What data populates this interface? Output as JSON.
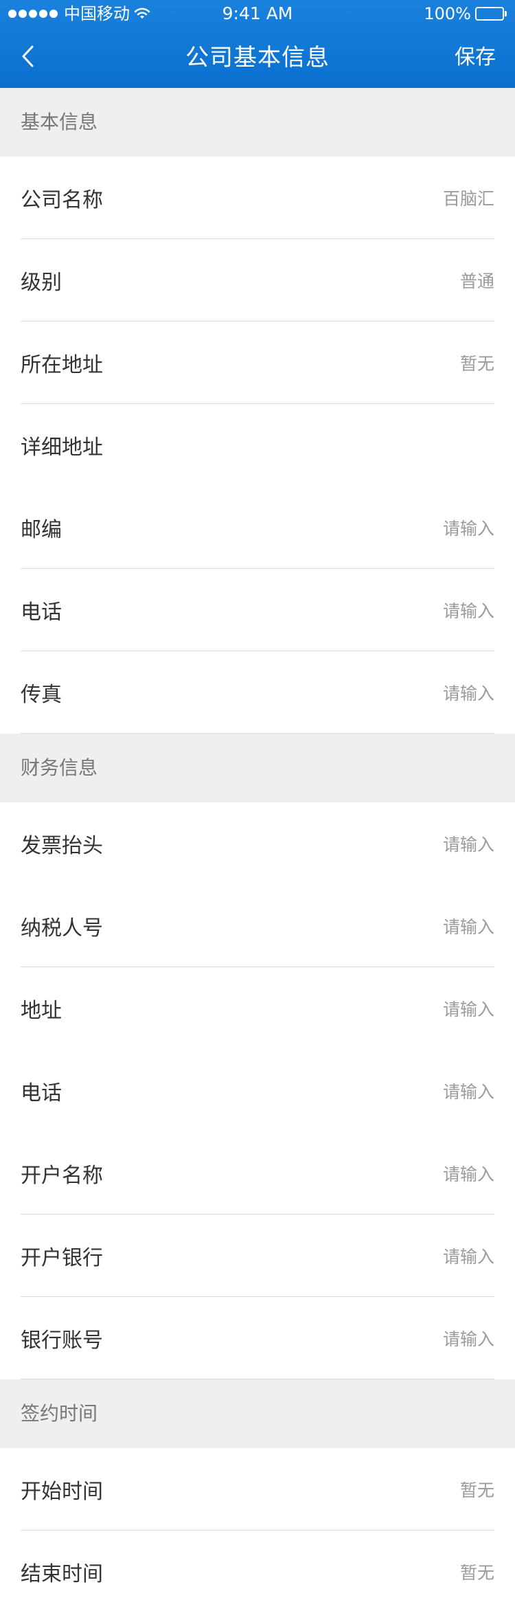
{
  "status_bar": {
    "carrier": "中国移动",
    "time": "9:41 AM",
    "battery": "100%"
  },
  "nav": {
    "title": "公司基本信息",
    "save_label": "保存"
  },
  "sections": [
    {
      "title": "基本信息",
      "rows": [
        {
          "label": "公司名称",
          "value": "百脑汇"
        },
        {
          "label": "级别",
          "value": "普通"
        },
        {
          "label": "所在地址",
          "value": "暂无"
        },
        {
          "label": "详细地址",
          "value": ""
        },
        {
          "label": "邮编",
          "value": "请输入"
        },
        {
          "label": "电话",
          "value": "请输入"
        },
        {
          "label": "传真",
          "value": "请输入"
        }
      ]
    },
    {
      "title": "财务信息",
      "rows": [
        {
          "label": "发票抬头",
          "value": "请输入"
        },
        {
          "label": "纳税人号",
          "value": "请输入"
        },
        {
          "label": "地址",
          "value": "请输入"
        },
        {
          "label": "电话",
          "value": "请输入"
        },
        {
          "label": "开户名称",
          "value": "请输入"
        },
        {
          "label": "开户银行",
          "value": "请输入"
        },
        {
          "label": "银行账号",
          "value": "请输入"
        }
      ]
    },
    {
      "title": "签约时间",
      "rows": [
        {
          "label": "开始时间",
          "value": "暂无"
        },
        {
          "label": "结束时间",
          "value": "暂无"
        }
      ]
    }
  ],
  "colors": {
    "header_blue": "#0a6fcf",
    "section_bg": "#efefef",
    "divider": "#dddddd",
    "value_gray": "#9b9b9b"
  },
  "icons": {
    "back": "chevron-left-icon",
    "wifi": "wifi-icon",
    "battery": "battery-icon",
    "signal": "signal-dots-icon"
  }
}
